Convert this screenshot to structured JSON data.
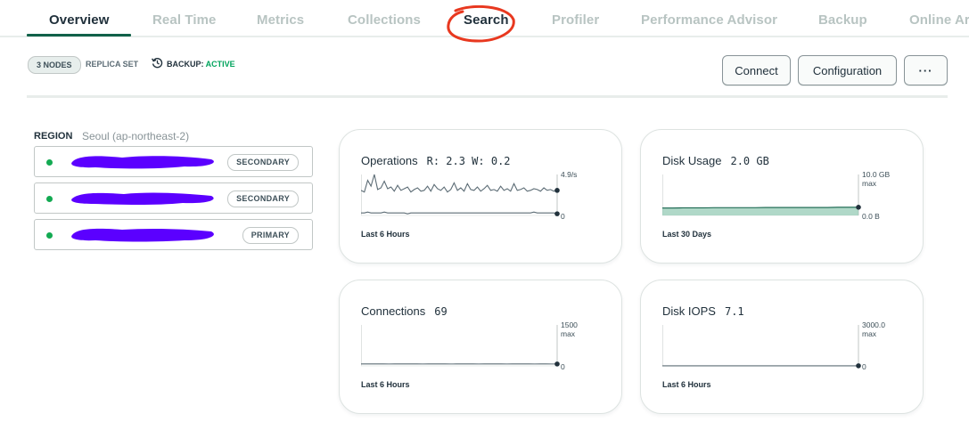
{
  "tabs": [
    "Overview",
    "Real Time",
    "Metrics",
    "Collections",
    "Search",
    "Profiler",
    "Performance Advisor",
    "Backup",
    "Online Ar"
  ],
  "cluster": {
    "nodes_badge": "3 NODES",
    "type_label": "REPLICA SET",
    "backup_label": "BACKUP:",
    "backup_status": "ACTIVE"
  },
  "actions": {
    "connect": "Connect",
    "configuration": "Configuration",
    "more": "···"
  },
  "region": {
    "label": "REGION",
    "name": "Seoul (ap-northeast-2)",
    "nodes": [
      {
        "role": "SECONDARY",
        "status_color": "#13aa52"
      },
      {
        "role": "SECONDARY",
        "status_color": "#13aa52"
      },
      {
        "role": "PRIMARY",
        "status_color": "#13aa52"
      }
    ]
  },
  "metrics": [
    {
      "title": "Operations",
      "value": "R: 2.3  W: 0.2",
      "period": "Last 6 Hours",
      "max_label": "4.9/s",
      "max_suffix": "",
      "min_label": "0",
      "series": [
        [
          3.0,
          2.8,
          4.2,
          3.5,
          4.9,
          3.1,
          3.3,
          4.1,
          3.2,
          3.4,
          2.9,
          3.6,
          3.0,
          3.2,
          3.4,
          2.8,
          3.1,
          3.3,
          2.9,
          3.0,
          3.5,
          2.9,
          3.7,
          3.2,
          3.0,
          3.4,
          2.8,
          3.1,
          3.9,
          3.0,
          3.3,
          2.9,
          3.8,
          3.1,
          3.0,
          3.4,
          2.9,
          3.2,
          3.6,
          3.0,
          3.1,
          2.9,
          3.5,
          3.0,
          3.2,
          2.9,
          3.8,
          3.0,
          3.1,
          3.3,
          2.9,
          3.0,
          3.2,
          3.1,
          2.9,
          3.3,
          3.0,
          3.1,
          2.9,
          3.0
        ],
        [
          0.3,
          0.3,
          0.4,
          0.3,
          0.3,
          0.3,
          0.3,
          0.4,
          0.3,
          0.3,
          0.3,
          0.3,
          0.3,
          0.3,
          0.2,
          0.3,
          0.3,
          0.3,
          0.3,
          0.3,
          0.3,
          0.3,
          0.3,
          0.3,
          0.3,
          0.3,
          0.3,
          0.3,
          0.3,
          0.3,
          0.3,
          0.3,
          0.3,
          0.3,
          0.3,
          0.3,
          0.3,
          0.3,
          0.3,
          0.3,
          0.3,
          0.3,
          0.3,
          0.3,
          0.3,
          0.3,
          0.3,
          0.3,
          0.3,
          0.3,
          0.3,
          0.3,
          0.4,
          0.3,
          0.3,
          0.3,
          0.3,
          0.3,
          0.3,
          0.2
        ]
      ],
      "ymax": 4.9,
      "fill": false
    },
    {
      "title": "Disk Usage",
      "value": "2.0 GB",
      "period": "Last 30 Days",
      "max_label": "10.0 GB",
      "max_suffix": "max",
      "min_label": "0.0 B",
      "series": [
        [
          1.8,
          1.8,
          1.85,
          1.85,
          1.85,
          1.9,
          1.9,
          1.9,
          1.9,
          1.9,
          1.95,
          1.95,
          1.95,
          1.95,
          1.95,
          1.95,
          1.95,
          2.0,
          2.0,
          2.0
        ]
      ],
      "ymax": 10.0,
      "fill": true
    },
    {
      "title": "Connections",
      "value": "69",
      "period": "Last 6 Hours",
      "max_label": "1500",
      "max_suffix": "max",
      "min_label": "0",
      "series": [
        [
          70,
          72,
          71,
          73,
          70,
          69,
          71,
          72,
          70,
          70,
          71,
          69,
          70,
          72,
          71,
          70,
          69,
          70,
          71,
          70,
          70,
          69,
          70,
          71,
          70,
          70,
          69,
          70,
          70,
          71,
          70,
          69,
          70,
          70,
          69,
          69
        ]
      ],
      "ymax": 1500,
      "fill": false
    },
    {
      "title": "Disk IOPS",
      "value": "7.1",
      "period": "Last 6 Hours",
      "max_label": "3000.0",
      "max_suffix": "max",
      "min_label": "0",
      "series": [
        [
          7,
          7,
          7,
          7,
          7,
          7,
          7,
          7,
          7,
          7,
          7,
          7,
          7,
          7,
          7,
          7,
          7,
          7,
          7,
          7.1
        ]
      ],
      "ymax": 3000,
      "fill": false
    }
  ],
  "colors": {
    "accent": "#116149",
    "active_green": "#00a35c",
    "chart_line": "#5c6c75",
    "chart_fill": "#8fc7b1",
    "annotation_red": "#e8381f",
    "redaction": "#5b00ff"
  }
}
